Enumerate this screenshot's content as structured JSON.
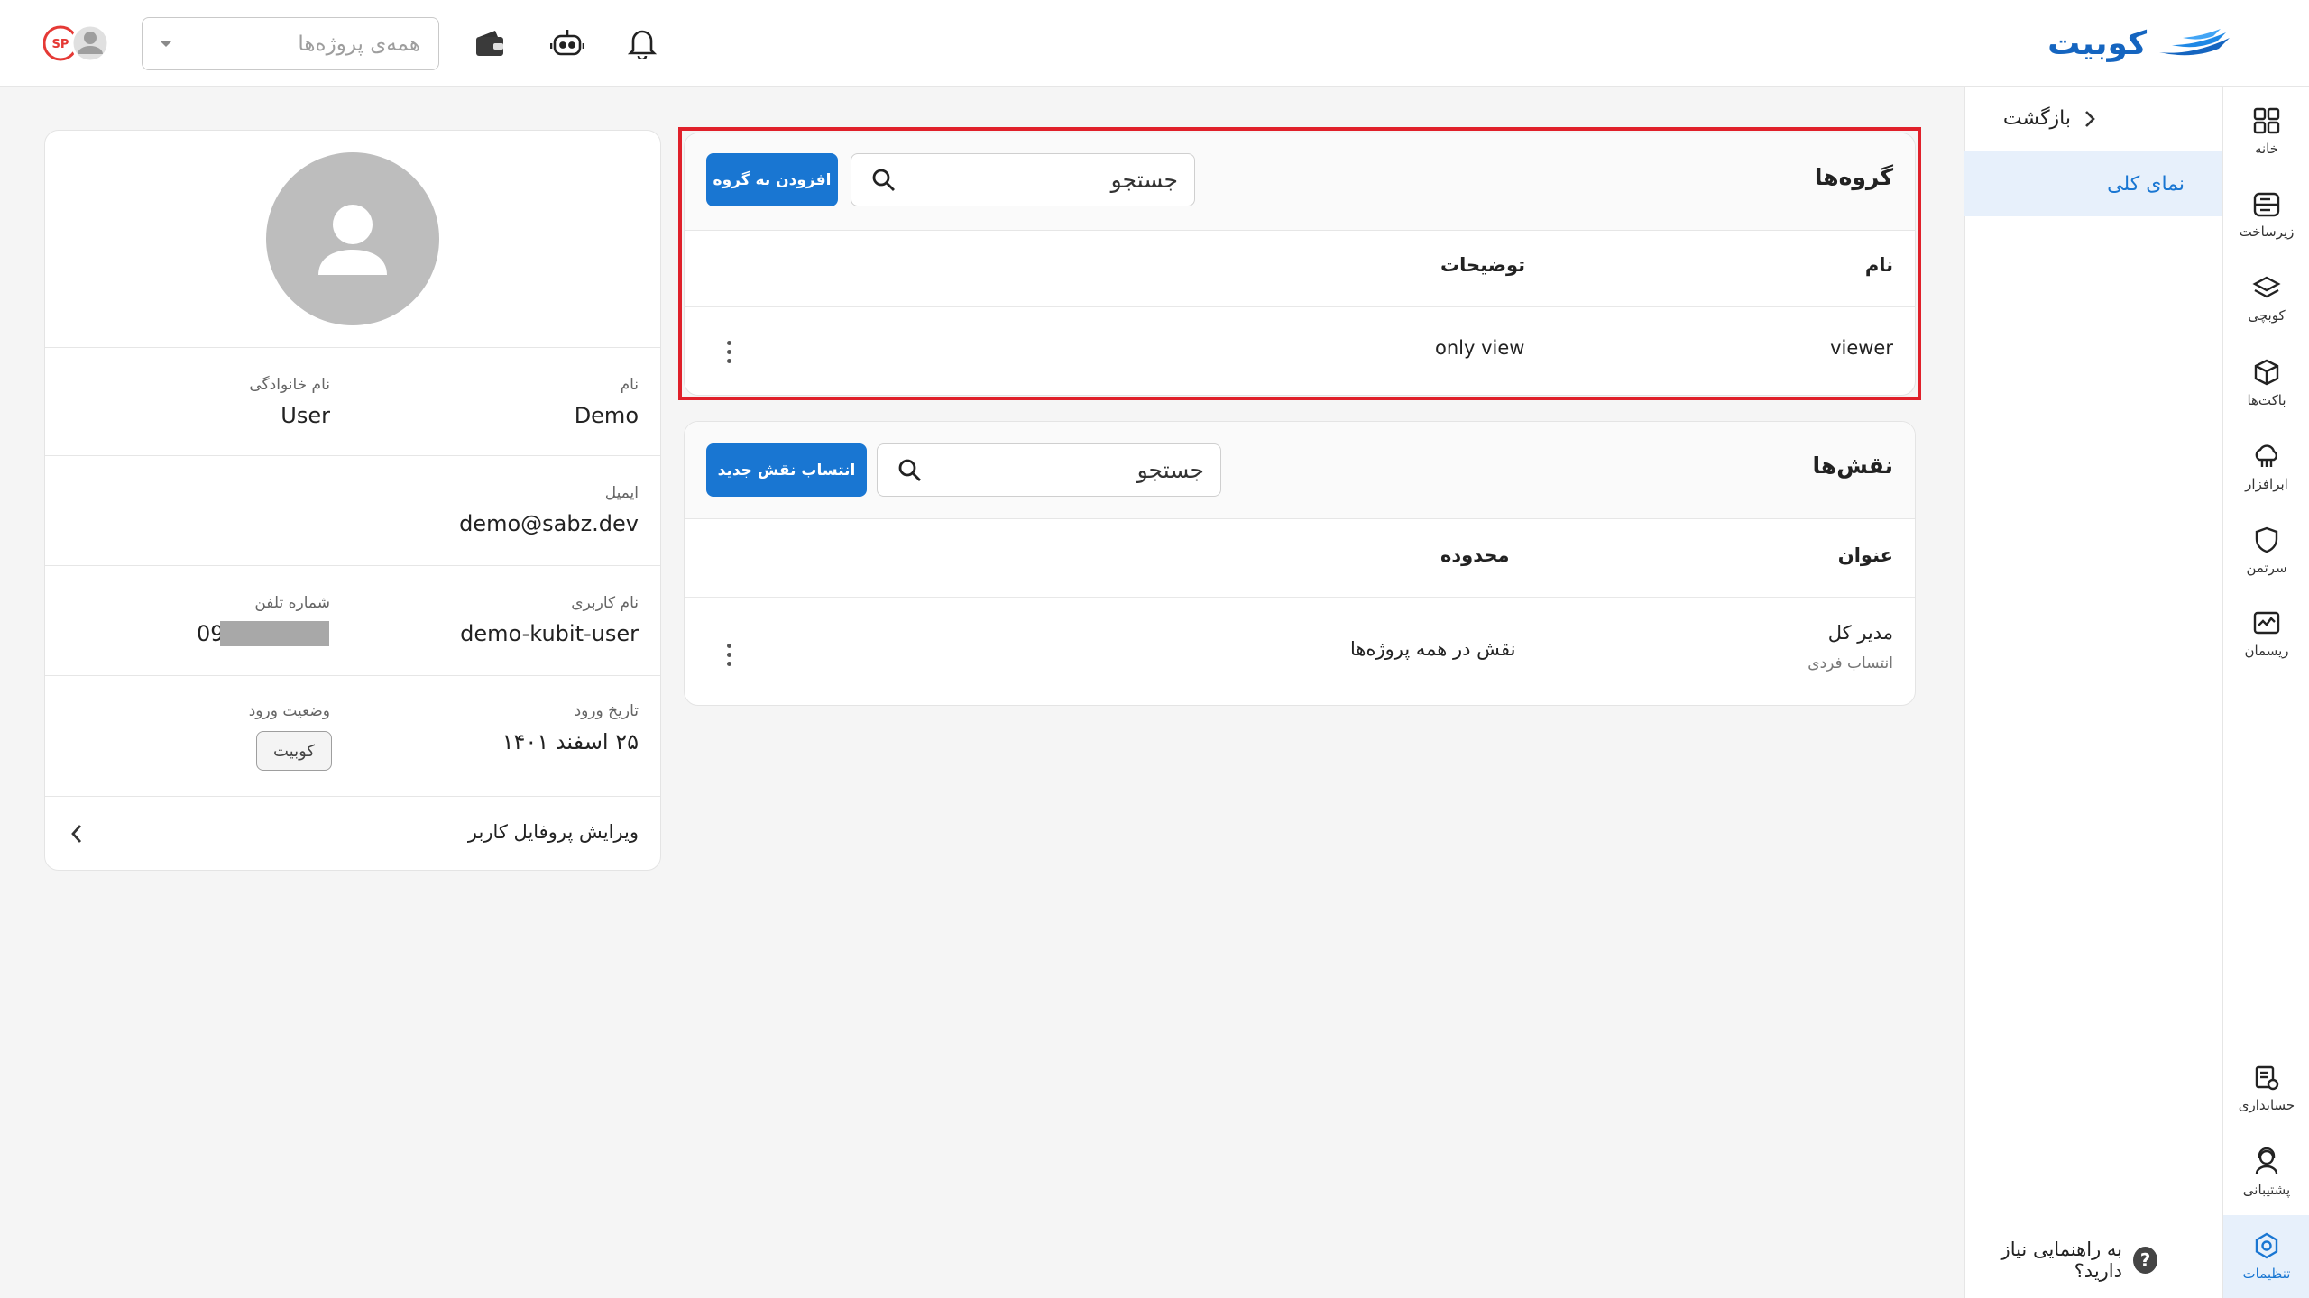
{
  "brand": {
    "name": "کوبیت",
    "accent": "#1976d2"
  },
  "topbar": {
    "project_placeholder": "همه‌ی پروژه‌ها",
    "icons": [
      "bell-icon",
      "robot-icon",
      "wallet-icon",
      "avatar-icon",
      "logo-badge-icon"
    ]
  },
  "rail": {
    "items": [
      {
        "label": "خانه",
        "icon": "grid-icon"
      },
      {
        "label": "زیرساخت",
        "icon": "server-icon"
      },
      {
        "label": "کوبچی",
        "icon": "layers-icon"
      },
      {
        "label": "باکت‌ها",
        "icon": "cube-icon"
      },
      {
        "label": "ابرافزار",
        "icon": "cloud-app-icon"
      },
      {
        "label": "سرتمن",
        "icon": "shield-icon"
      },
      {
        "label": "ریسمان",
        "icon": "monitor-chart-icon"
      }
    ],
    "bottom_items": [
      {
        "label": "حسابداری",
        "icon": "invoice-icon"
      },
      {
        "label": "پشتیبانی",
        "icon": "support-icon"
      },
      {
        "label": "تنظیمات",
        "icon": "settings-icon"
      }
    ]
  },
  "subnav": {
    "back_label": "بازگشت",
    "overview_label": "نمای کلی",
    "help_label": "به راهنمایی نیاز دارید؟",
    "help_mark": "?"
  },
  "groups": {
    "title": "گروه‌ها",
    "search_placeholder": "جستجو",
    "add_button": "افزودن به گروه",
    "columns": {
      "name": "نام",
      "description": "توضیحات"
    },
    "rows": [
      {
        "name": "viewer",
        "description": "only view"
      }
    ]
  },
  "roles": {
    "title": "نقش‌ها",
    "search_placeholder": "جستجو",
    "assign_button": "انتساب نقش جدید",
    "columns": {
      "title": "عنوان",
      "scope": "محدوده"
    },
    "rows": [
      {
        "title": "مدیر کل",
        "subtitle": "انتساب فردی",
        "scope": "نقش در همه پروژه‌ها"
      }
    ]
  },
  "profile": {
    "first_name_label": "نام",
    "first_name": "Demo",
    "last_name_label": "نام خانوادگی",
    "last_name": "User",
    "email_label": "ایمیل",
    "email": "demo@sabz.dev",
    "username_label": "نام کاربری",
    "username": "demo-kubit-user",
    "phone_label": "شماره تلفن",
    "phone_prefix": "09",
    "login_date_label": "تاریخ ورود",
    "login_date": "۲۵ اسفند ۱۴۰۱",
    "login_status_label": "وضعیت ورود",
    "login_status": "کوبیت",
    "edit_label": "ویرایش پروفایل کاربر"
  }
}
